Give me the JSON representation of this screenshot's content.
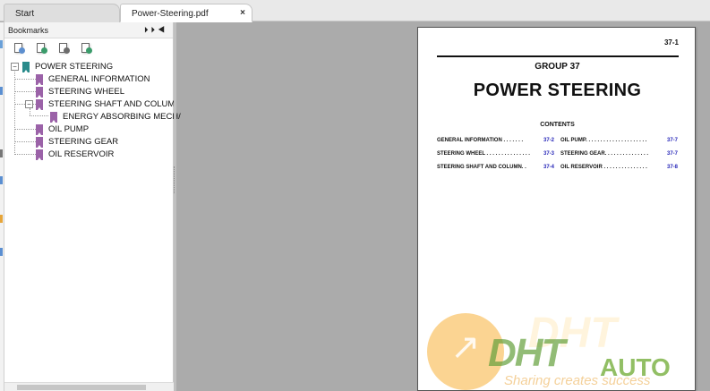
{
  "tabs": {
    "start_label": "Start",
    "document_label": "Power-Steering.pdf",
    "close_symbol": "×"
  },
  "bookmarks_panel": {
    "title": "Bookmarks",
    "controls": [
      "⏵⏵",
      "◀"
    ],
    "tool_icons": [
      "expand-bookmark-icon",
      "add-bookmark-icon",
      "go-to-bookmark-icon",
      "bookmark-options-icon"
    ],
    "tree": [
      {
        "label": "POWER STEERING",
        "level": 0,
        "expanded": true,
        "color": "#2a8b8b"
      },
      {
        "label": "GENERAL INFORMATION",
        "level": 1,
        "color": "#9b62a8"
      },
      {
        "label": "STEERING WHEEL",
        "level": 1,
        "color": "#9b62a8"
      },
      {
        "label": "STEERING SHAFT AND COLUMI",
        "level": 1,
        "expanded": true,
        "color": "#9b62a8"
      },
      {
        "label": "ENERGY ABSORBING MECH/",
        "level": 2,
        "color": "#9b62a8"
      },
      {
        "label": "OIL PUMP",
        "level": 1,
        "color": "#9b62a8"
      },
      {
        "label": "STEERING GEAR",
        "level": 1,
        "color": "#9b62a8"
      },
      {
        "label": "OIL RESERVOIR",
        "level": 1,
        "color": "#9b62a8"
      }
    ]
  },
  "document": {
    "page_number": "37-1",
    "group": "GROUP 37",
    "title": "POWER STEERING",
    "contents_heading": "CONTENTS",
    "toc_left": [
      {
        "text": "GENERAL INFORMATION . . . . . . .",
        "page": "37-2"
      },
      {
        "text": "STEERING WHEEL . . . . . . . . . . . . . . .",
        "page": "37-3"
      },
      {
        "text": "STEERING SHAFT AND COLUMN. .",
        "page": "37-4"
      }
    ],
    "toc_right": [
      {
        "text": "OIL PUMP. . . . . . . . . . . . . . . . . . . . .",
        "page": "37-7"
      },
      {
        "text": "STEERING GEAR. . . . . . . . . . . . . . .",
        "page": "37-7"
      },
      {
        "text": "OIL RESERVOIR . . . . . . . . . . . . . . .",
        "page": "37-8"
      }
    ],
    "link_color": "#2626b8"
  },
  "watermark": {
    "brand_main": "DHT",
    "brand_suffix": "AUTO",
    "ghost_text": "DHT",
    "slogan": "Sharing creates success"
  }
}
